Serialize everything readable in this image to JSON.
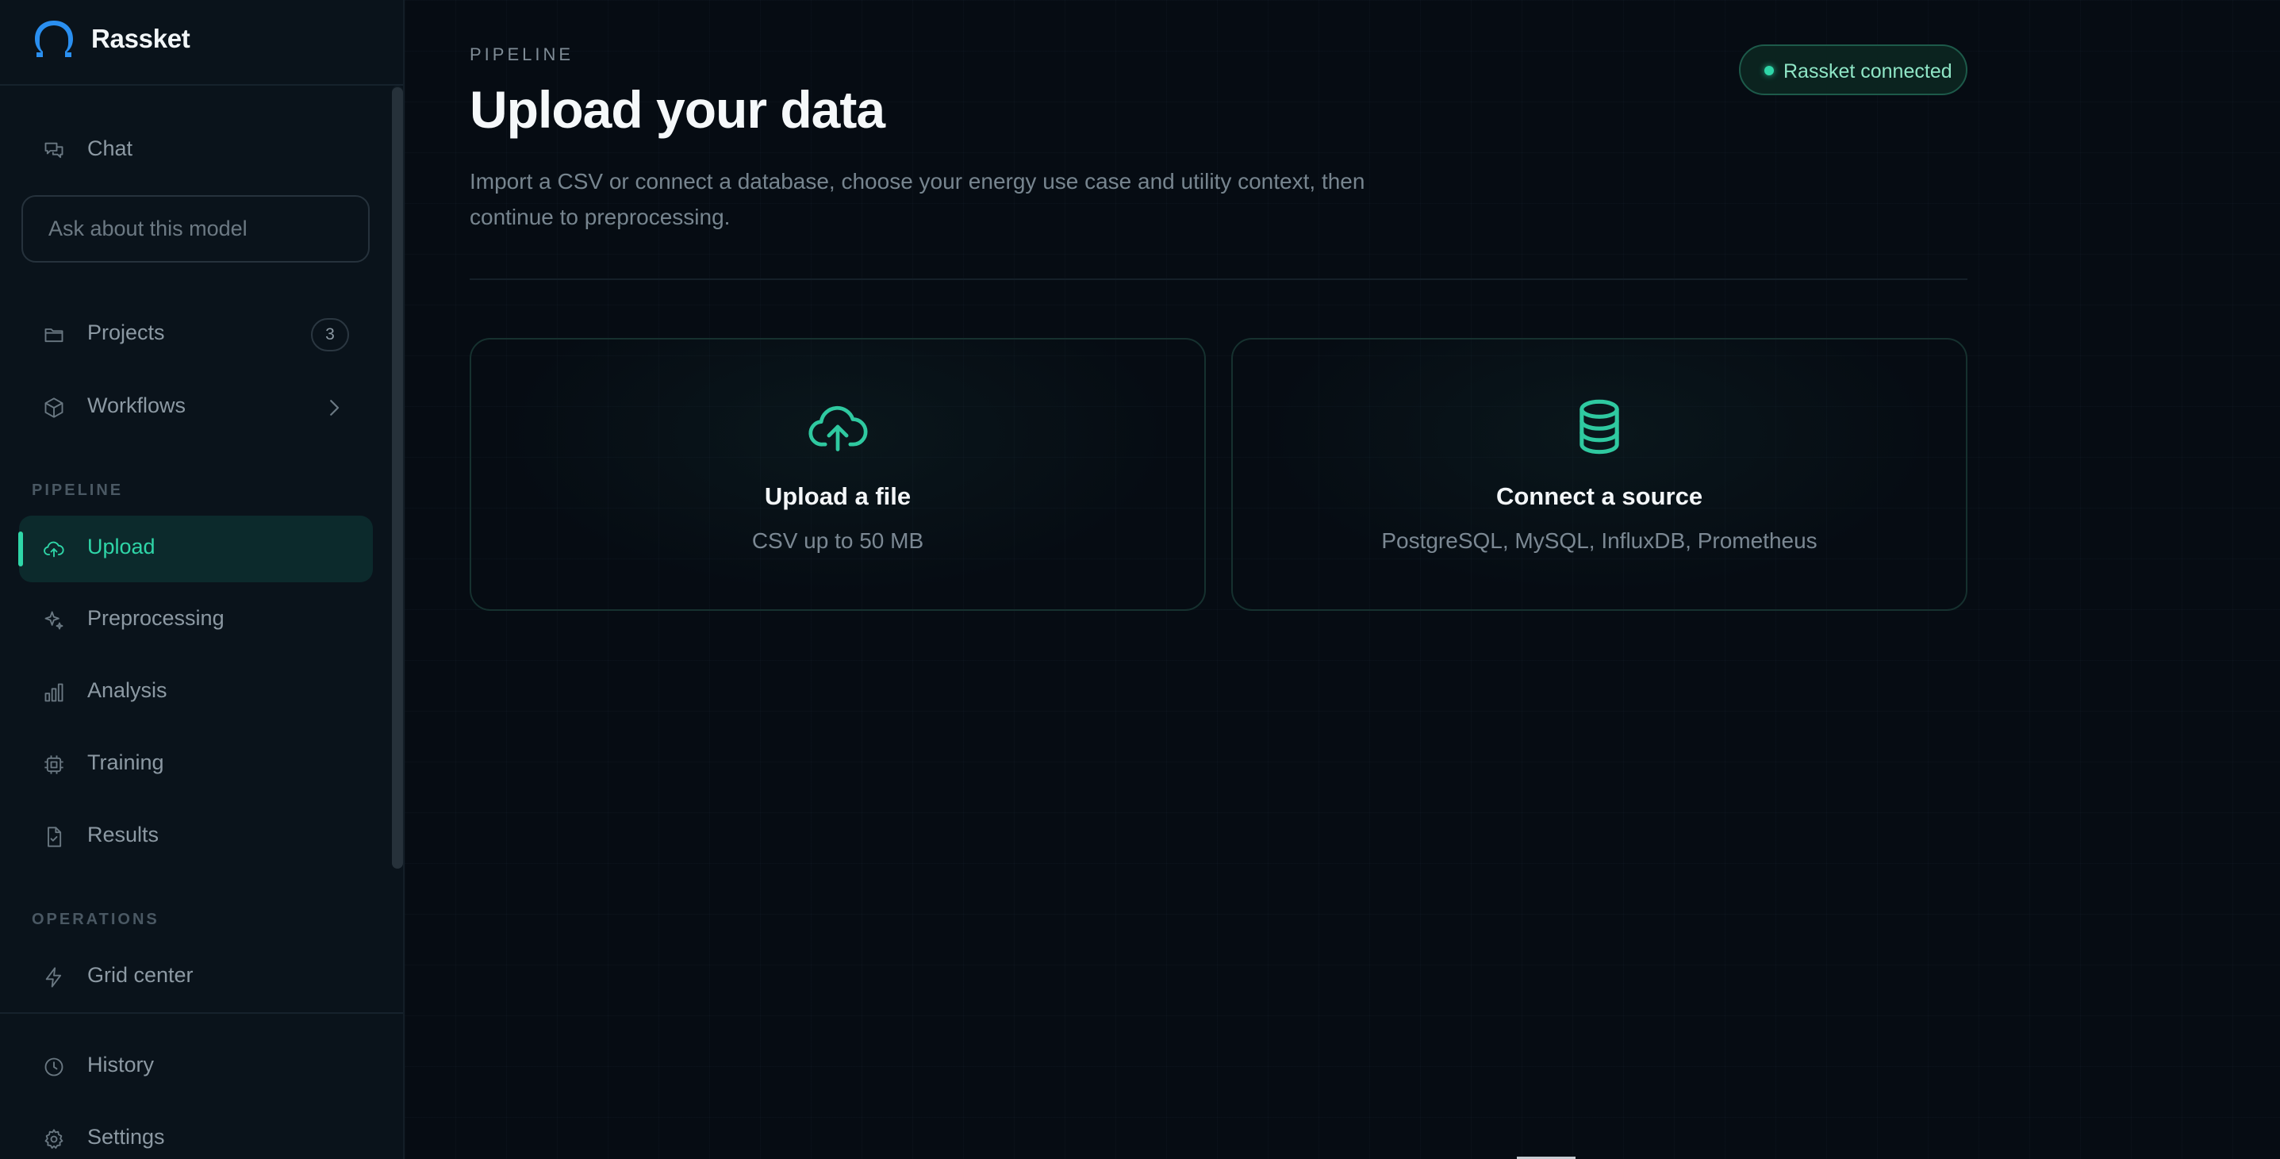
{
  "app": {
    "name": "Rassket"
  },
  "sidebar": {
    "chat_label": "Chat",
    "ask_placeholder": "Ask about this model",
    "projects": {
      "label": "Projects",
      "count": "3"
    },
    "workflows_label": "Workflows",
    "pipeline_heading": "PIPELINE",
    "pipeline_items": [
      {
        "label": "Upload",
        "icon": "cloud-upload-icon",
        "active": true
      },
      {
        "label": "Preprocessing",
        "icon": "sparkles-icon"
      },
      {
        "label": "Analysis",
        "icon": "bar-chart-icon"
      },
      {
        "label": "Training",
        "icon": "cpu-icon"
      },
      {
        "label": "Results",
        "icon": "file-check-icon"
      }
    ],
    "operations_heading": "OPERATIONS",
    "grid_center_label": "Grid center",
    "history_label": "History",
    "settings_label": "Settings"
  },
  "main": {
    "eyebrow": "PIPELINE",
    "title": "Upload your data",
    "description": "Import a CSV or connect a database, choose your energy use case and utility context, then continue to preprocessing.",
    "status": "Rassket connected",
    "cards": [
      {
        "title": "Upload a file",
        "subtitle": "CSV up to 50 MB",
        "icon": "cloud-upload-icon"
      },
      {
        "title": "Connect a source",
        "subtitle": "PostgreSQL, MySQL, InfluxDB, Prometheus",
        "icon": "database-icon"
      }
    ]
  },
  "colors": {
    "accent": "#2fd6a8",
    "background": "#060c13",
    "sidebar": "#0a131b"
  }
}
